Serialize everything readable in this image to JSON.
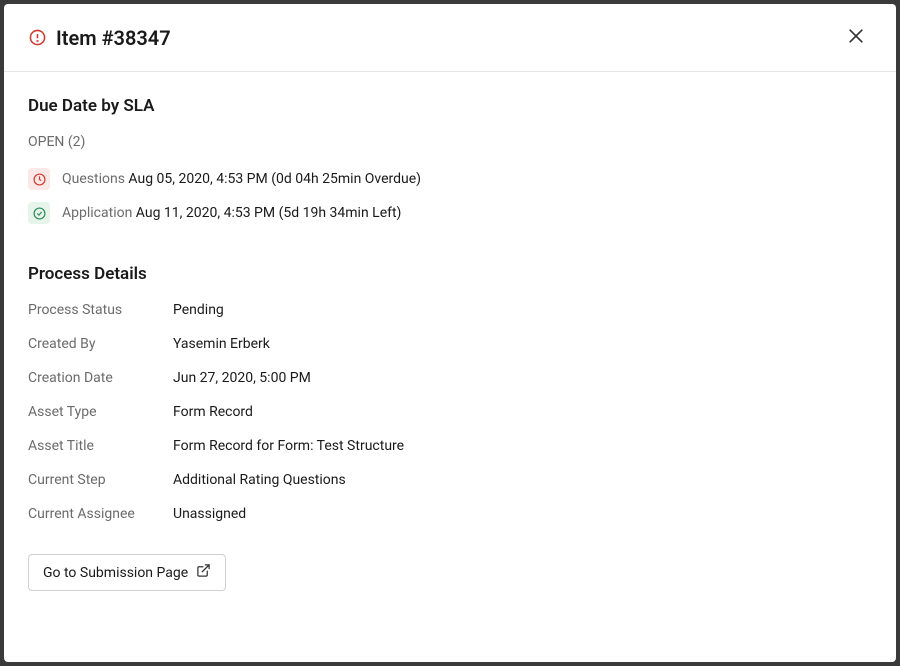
{
  "header": {
    "title": "Item #38347"
  },
  "sla": {
    "section_title": "Due Date by SLA",
    "open_label": "OPEN (2)",
    "items": [
      {
        "status": "overdue",
        "label": "Questions",
        "date": "Aug 05, 2020, 4:53 PM",
        "remaining": "(0d 04h 25min Overdue)"
      },
      {
        "status": "ok",
        "label": "Application",
        "date": "Aug 11, 2020, 4:53 PM",
        "remaining": "(5d 19h 34min Left)"
      }
    ]
  },
  "details": {
    "section_title": "Process Details",
    "fields": {
      "process_status": {
        "label": "Process Status",
        "value": "Pending"
      },
      "created_by": {
        "label": "Created By",
        "value": "Yasemin Erberk"
      },
      "creation_date": {
        "label": "Creation Date",
        "value": "Jun 27, 2020, 5:00 PM"
      },
      "asset_type": {
        "label": "Asset Type",
        "value": "Form Record"
      },
      "asset_title": {
        "label": "Asset Title",
        "value": "Form Record for Form: Test Structure"
      },
      "current_step": {
        "label": "Current Step",
        "value": "Additional Rating Questions"
      },
      "current_assignee": {
        "label": "Current Assignee",
        "value": "Unassigned"
      }
    }
  },
  "actions": {
    "go_submission": "Go to Submission Page"
  }
}
